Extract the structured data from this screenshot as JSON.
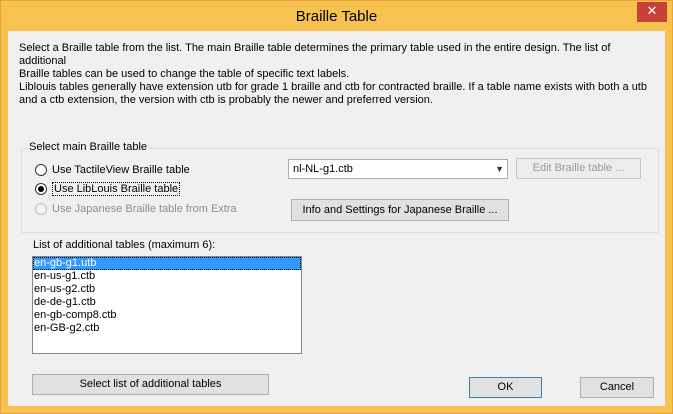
{
  "window": {
    "title": "Braille Table",
    "close_glyph": "✕"
  },
  "description": "Select a Braille table from the list. The main Braille table determines the primary table used in the entire design. The list of additional\nBraille tables can be used to change the table of specific text labels.\nLiblouis tables generally have extension utb for grade 1 braille and ctb for contracted braille. If a table name exists with both a utb\nand a ctb extension, the version with ctb is probably the newer and preferred version.",
  "main_group": {
    "legend": "Select main Braille table",
    "options": [
      {
        "label": "Use TactileView Braille table",
        "checked": false,
        "disabled": false
      },
      {
        "label": "Use LibLouis Braille table",
        "checked": true,
        "disabled": false
      },
      {
        "label": "Use Japanese Braille table from Extra",
        "checked": false,
        "disabled": true
      }
    ],
    "table_select": {
      "value": "nl-NL-g1.ctb"
    },
    "edit_button": "Edit Braille table ...",
    "info_button": "Info and Settings for Japanese Braille ..."
  },
  "additional": {
    "label": "List of additional tables (maximum 6):",
    "items": [
      "en-gb-g1.utb",
      "en-us-g1.ctb",
      "en-us-g2.ctb",
      "de-de-g1.ctb",
      "en-gb-comp8.ctb",
      "en-GB-g2.ctb"
    ],
    "selected_index": 0
  },
  "buttons": {
    "select_list": "Select list of additional tables",
    "ok": "OK",
    "cancel": "Cancel"
  },
  "colors": {
    "title_bar": "#f8c251",
    "close": "#c7403a",
    "selection": "#3399ff"
  }
}
